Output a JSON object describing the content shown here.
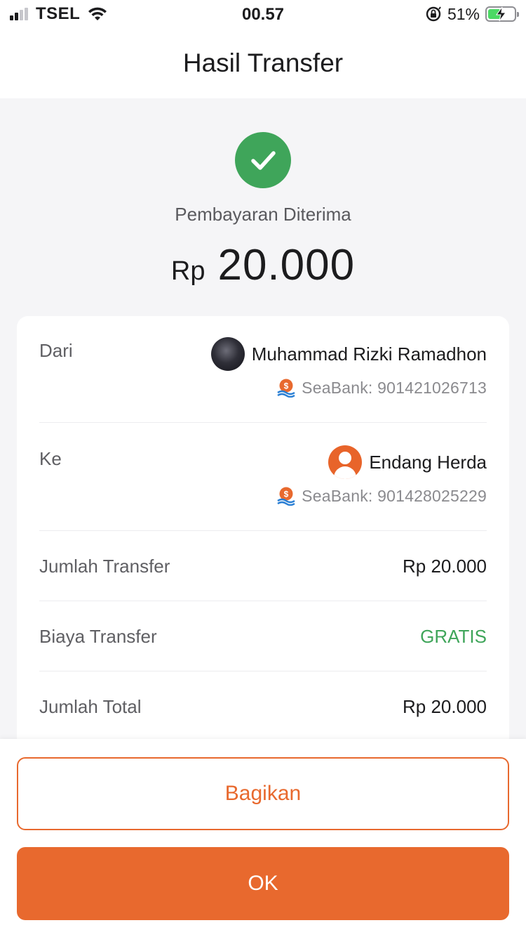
{
  "status_bar": {
    "carrier": "TSEL",
    "time": "00.57",
    "battery_percent": "51%",
    "battery_level": 0.51,
    "signal_icon": "cellular-signal-icon",
    "wifi_icon": "wifi-icon",
    "orientation_lock_icon": "orientation-lock-icon",
    "battery_icon": "battery-charging-icon"
  },
  "header": {
    "title": "Hasil Transfer"
  },
  "result": {
    "icon": "check-icon",
    "status": "Pembayaran Diterima",
    "currency": "Rp",
    "amount": "20.000"
  },
  "details": {
    "from": {
      "label": "Dari",
      "name": "Muhammad Rizki Ramadhon",
      "bank": "SeaBank: 901421026713"
    },
    "to": {
      "label": "Ke",
      "name": "Endang Herda",
      "bank": "SeaBank: 901428025229"
    },
    "rows": [
      {
        "label": "Jumlah Transfer",
        "value": "Rp 20.000"
      },
      {
        "label": "Biaya Transfer",
        "value": "GRATIS"
      },
      {
        "label": "Jumlah Total",
        "value": "Rp 20.000"
      }
    ]
  },
  "actions": {
    "share": "Bagikan",
    "ok": "OK"
  },
  "colors": {
    "accent": "#e8692e",
    "success": "#3fa55a",
    "background": "#f5f5f7"
  }
}
